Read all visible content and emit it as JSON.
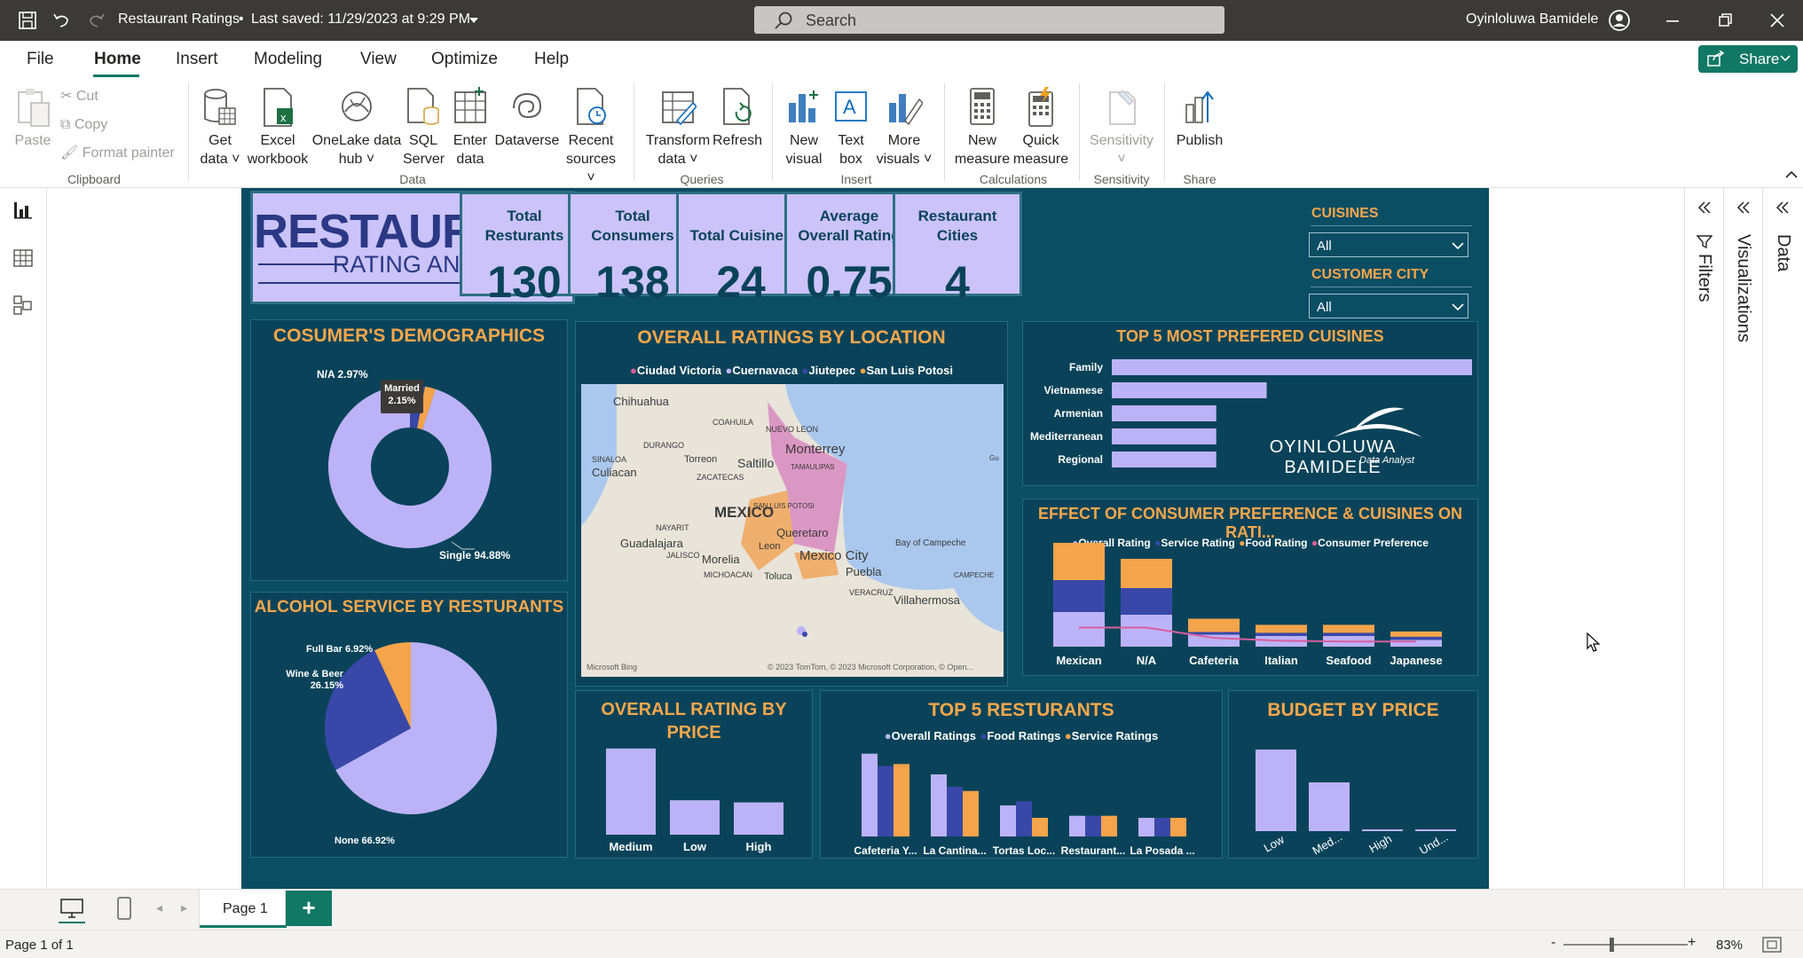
{
  "titlebar": {
    "title": "Restaurant Ratings",
    "saved": "Last saved: 11/29/2023 at 9:29 PM",
    "search_placeholder": "Search",
    "user": "Oyinloluwa Bamidele"
  },
  "menu": {
    "file": "File",
    "home": "Home",
    "insert": "Insert",
    "modeling": "Modeling",
    "view": "View",
    "optimize": "Optimize",
    "help": "Help",
    "share": "Share"
  },
  "ribbon": {
    "paste": "Paste",
    "cut": "Cut",
    "copy": "Copy",
    "format_painter": "Format painter",
    "clipboard": "Clipboard",
    "get_data_1": "Get",
    "get_data_2": "data",
    "excel_1": "Excel",
    "excel_2": "workbook",
    "onelake_1": "OneLake data",
    "onelake_2": "hub",
    "sql_1": "SQL",
    "sql_2": "Server",
    "enter_1": "Enter",
    "enter_2": "data",
    "dataverse": "Dataverse",
    "recent_1": "Recent",
    "recent_2": "sources",
    "data_group": "Data",
    "transform_1": "Transform",
    "transform_2": "data",
    "refresh": "Refresh",
    "queries": "Queries",
    "new_visual_1": "New",
    "new_visual_2": "visual",
    "textbox_1": "Text",
    "textbox_2": "box",
    "more_1": "More",
    "more_2": "visuals",
    "insert_group": "Insert",
    "new_measure_1": "New",
    "new_measure_2": "measure",
    "quick_1": "Quick",
    "quick_2": "measure",
    "calculations": "Calculations",
    "sensitivity": "Sensitivity",
    "sensitivity_group": "Sensitivity",
    "publish": "Publish",
    "share_group": "Share"
  },
  "report": {
    "logo_line1": "RESTAURANT",
    "logo_line2": "RATING ANALYSIS",
    "kpis": [
      {
        "label1": "Total",
        "label2": "Resturants",
        "value": "130"
      },
      {
        "label1": "Total",
        "label2": "Consumers",
        "value": "138"
      },
      {
        "label1": "",
        "label2": "Total Cuisines",
        "value": "24"
      },
      {
        "label1": "Average",
        "label2": "Overall Rating",
        "value": "0.75"
      },
      {
        "label1": "Restaurant",
        "label2": "Cities",
        "value": "4"
      }
    ],
    "slicer_cuisines": {
      "title": "CUISINES",
      "value": "All"
    },
    "slicer_city": {
      "title": "CUSTOMER CITY",
      "value": "All"
    },
    "demographics_title": "COSUMER'S DEMOGRAPHICS",
    "location_title": "OVERALL RATINGS BY LOCATION",
    "cuisines_title": "TOP 5 MOST PREFERED CUISINES",
    "effect_title": "EFFECT OF CONSUMER PREFERENCE & CUISINES ON RATI...",
    "alcohol_title": "ALCOHOL SERVICE BY RESTURANTS",
    "price_title_1": "OVERALL RATING BY",
    "price_title_2": "PRICE",
    "top5_title": "TOP 5 RESTURANTS",
    "budget_title": "BUDGET BY PRICE",
    "brand_name": "OYINLOLUWA BAMIDELE",
    "brand_role": "Data Analyst",
    "map": {
      "legend": [
        "Ciudad Victoria",
        "Cuernavaca",
        "Jiutepec",
        "San Luis Potosi"
      ],
      "places": [
        "Chihuahua",
        "COAHUILA",
        "NUEVO LEON",
        "Monterrey",
        "DURANGO",
        "SINALOA",
        "Torreon",
        "Saltillo",
        "TAMAULIPAS",
        "Culiacan",
        "ZACATECAS",
        "SAN LUIS POTOSI",
        "MEXICO",
        "NAYARIT",
        "Queretaro",
        "Guadalajara",
        "JALISCO",
        "Leon",
        "Bay of Campeche",
        "Morelia",
        "Mexico City",
        "MICHOACAN",
        "Toluca",
        "Puebla",
        "VERACRUZ",
        "CAMPECHE",
        "Villahermosa",
        "Gu"
      ],
      "bing": "Microsoft Bing",
      "copyright": "© 2023 TomTom, © 2023 Microsoft Corporation, © Open..."
    }
  },
  "chart_data": [
    {
      "type": "pie",
      "donut": true,
      "title": "COSUMER'S DEMOGRAPHICS",
      "labels": [
        "Single",
        "Married",
        "N/A"
      ],
      "values": [
        94.88,
        2.15,
        2.97
      ],
      "label_text": [
        "Single 94.88%",
        "Married 2.15%",
        "N/A 2.97%"
      ],
      "colors": [
        "#bcb2f7",
        "#f4a44a",
        "#3948a8"
      ]
    },
    {
      "type": "bar",
      "orientation": "horizontal",
      "title": "TOP 5 MOST PREFERED CUISINES",
      "categories": [
        "Family",
        "Vietnamese",
        "Armenian",
        "Mediterranean",
        "Regional"
      ],
      "values": [
        100,
        43,
        29,
        29,
        29
      ]
    },
    {
      "type": "bar",
      "stacked": true,
      "title": "EFFECT OF CONSUMER PREFERENCE & CUISINES ON RATI...",
      "categories": [
        "Mexican",
        "N/A",
        "Cafeteria",
        "Italian",
        "Seafood",
        "Japanese"
      ],
      "series": [
        {
          "name": "Overall Rating",
          "values": [
            1.3,
            1.2,
            0.45,
            0.4,
            0.4,
            0.25
          ]
        },
        {
          "name": "Service Rating",
          "values": [
            1.2,
            1.0,
            0.1,
            0.12,
            0.12,
            0.12
          ]
        },
        {
          "name": "Food Rating",
          "values": [
            1.4,
            1.1,
            0.5,
            0.3,
            0.3,
            0.2
          ]
        },
        {
          "name": "Consumer Preference",
          "values": [
            1.3,
            1.3,
            0.6,
            0.4,
            0.35,
            0.35
          ]
        }
      ],
      "colors": [
        "#bcb2f7",
        "#3948a8",
        "#f4a44a",
        "#d95f9e"
      ]
    },
    {
      "type": "pie",
      "title": "ALCOHOL SERVICE BY RESTURANTS",
      "labels": [
        "None",
        "Wine & Beer",
        "Full Bar"
      ],
      "values": [
        66.92,
        26.15,
        6.92
      ],
      "label_text": [
        "None 66.92%",
        "Wine & Beer 26.15%",
        "Full Bar 6.92%"
      ],
      "colors": [
        "#bcb2f7",
        "#3948a8",
        "#f4a44a"
      ]
    },
    {
      "type": "bar",
      "title": "OVERALL RATING BY PRICE",
      "categories": [
        "Medium",
        "Low",
        "High"
      ],
      "values": [
        2.0,
        0.8,
        0.75
      ],
      "ylim": [
        0,
        2.1
      ]
    },
    {
      "type": "bar",
      "title": "TOP 5 RESTURANTS",
      "categories": [
        "Cafeteria Y...",
        "La Cantina...",
        "Tortas Loc...",
        "Restaurant...",
        "La Posada ..."
      ],
      "series": [
        {
          "name": "Overall Ratings",
          "values": [
            2.0,
            1.5,
            0.75,
            0.5,
            0.45
          ]
        },
        {
          "name": "Food Ratings",
          "values": [
            1.7,
            1.2,
            0.85,
            0.5,
            0.45
          ]
        },
        {
          "name": "Service Ratings",
          "values": [
            1.75,
            1.1,
            0.45,
            0.5,
            0.45
          ]
        }
      ],
      "colors": [
        "#bcb2f7",
        "#3948a8",
        "#f4a44a"
      ],
      "ylim": [
        0,
        2.1
      ]
    },
    {
      "type": "bar",
      "title": "BUDGET BY PRICE",
      "categories": [
        "Low",
        "Med...",
        "High",
        "Und..."
      ],
      "values": [
        92,
        55,
        2,
        2
      ],
      "ylim": [
        0,
        100
      ]
    }
  ],
  "pages": {
    "tab": "Page 1",
    "status": "Page 1 of 1",
    "zoom": "83%"
  },
  "panes": {
    "filters": "Filters",
    "visualizations": "Visualizations",
    "data": "Data"
  }
}
